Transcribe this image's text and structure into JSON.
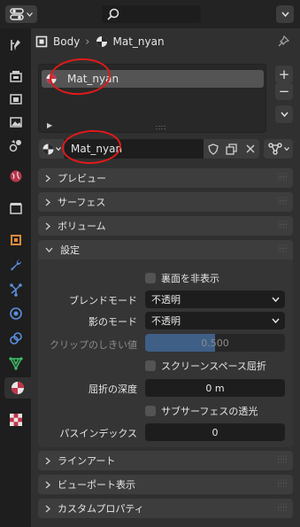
{
  "header": {
    "search_placeholder": ""
  },
  "breadcrumb": {
    "object": "Body",
    "material": "Mat_nyan"
  },
  "slots": {
    "items": [
      {
        "label": "Mat_nyan"
      }
    ]
  },
  "material_field": {
    "value": "Mat_nyan"
  },
  "panels": {
    "preview": "プレビュー",
    "surface": "サーフェス",
    "volume": "ボリューム",
    "settings": "設定",
    "lineart": "ラインアート",
    "viewport_display": "ビューポート表示",
    "custom_properties": "カスタムプロパティ"
  },
  "settings": {
    "backface_culling": {
      "label": "裏面を非表示",
      "checked": false
    },
    "blend_mode": {
      "label": "ブレンドモード",
      "value": "不透明"
    },
    "shadow_mode": {
      "label": "影のモード",
      "value": "不透明"
    },
    "clip_threshold": {
      "label": "クリップのしきい値",
      "value": "0.500",
      "fraction": 0.5
    },
    "screen_space_refraction": {
      "label": "スクリーンスペース屈折",
      "checked": false
    },
    "refraction_depth": {
      "label": "屈折の深度",
      "value": "0 m"
    },
    "subsurface_translucency": {
      "label": "サブサーフェスの透光",
      "checked": false
    },
    "pass_index": {
      "label": "パスインデックス",
      "value": "0"
    }
  },
  "colors": {
    "annotation": "#e01a1a",
    "slider_fill": "#3f5f87",
    "panel": "#3d3d3d",
    "background": "#303030"
  }
}
